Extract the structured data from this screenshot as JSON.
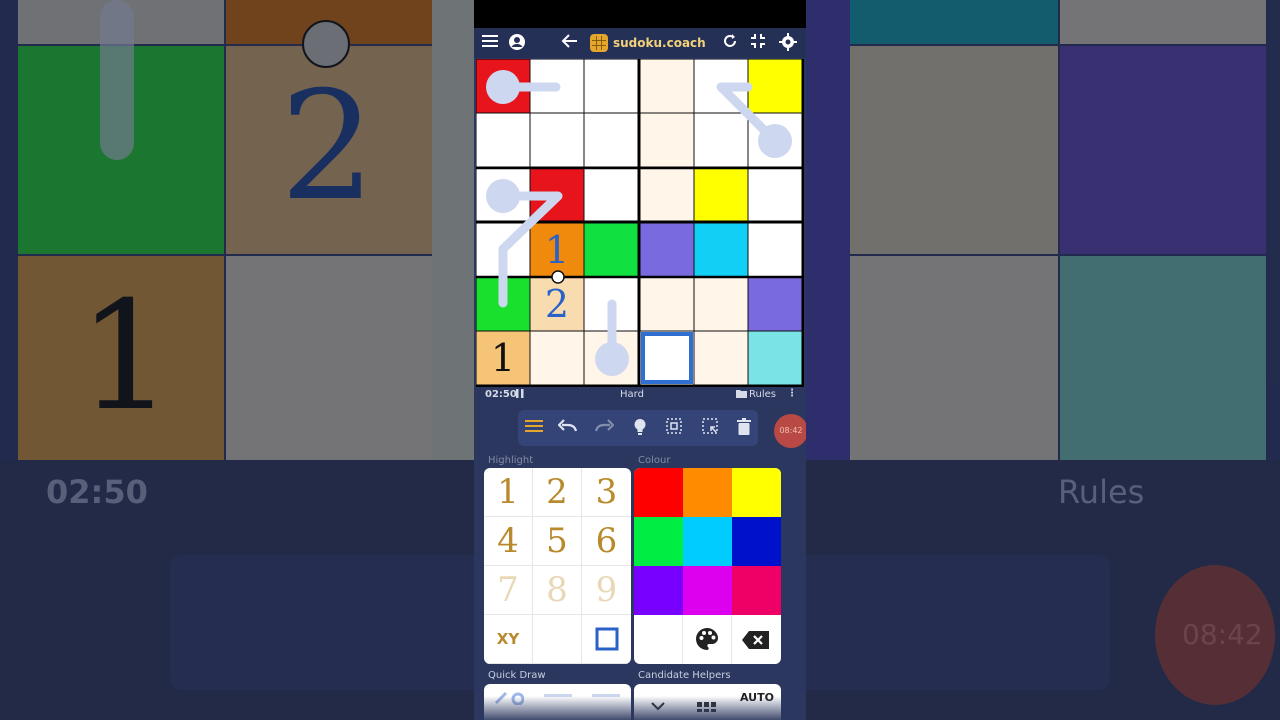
{
  "app": {
    "brand": "sudoku.coach"
  },
  "navbar": {
    "icons": [
      "menu-icon",
      "account-icon",
      "back-icon",
      "logo-icon",
      "refresh-icon",
      "fullscreen-exit-icon",
      "settings-icon"
    ]
  },
  "board": {
    "digits": [
      {
        "row": 3,
        "col": 1,
        "value": "1",
        "color": "#2a62c9"
      },
      {
        "row": 4,
        "col": 1,
        "value": "2",
        "color": "#2a62c9"
      },
      {
        "row": 5,
        "col": 0,
        "value": "1",
        "color": "#111111"
      }
    ]
  },
  "status": {
    "time": "02:50",
    "difficulty": "Hard",
    "rules_label": "Rules"
  },
  "toolbar": {
    "icons": [
      "menu-icon",
      "undo-icon",
      "redo-icon",
      "hint-icon",
      "select-all-icon",
      "deselect-icon",
      "delete-icon"
    ],
    "timer": "08:42"
  },
  "labels": {
    "highlight": "Highlight",
    "colour": "Colour",
    "quick_draw": "Quick Draw",
    "candidate_helpers": "Candidate Helpers"
  },
  "numpad": {
    "keys": [
      "1",
      "2",
      "3",
      "4",
      "5",
      "6",
      "7",
      "8",
      "9"
    ],
    "xy": "XY"
  },
  "colorpad": {
    "colors": [
      "#ff0000",
      "#ff8c00",
      "#ffff00",
      "#00ee44",
      "#00ccff",
      "#0011cc",
      "#7700ff",
      "#dd00ee",
      "#ee0066"
    ]
  },
  "candidate": {
    "auto": "AUTO"
  },
  "background": {
    "time": "02:50",
    "rules_label": "Rules",
    "timer": "08:42",
    "digit_2": "2",
    "digit_1": "1"
  }
}
